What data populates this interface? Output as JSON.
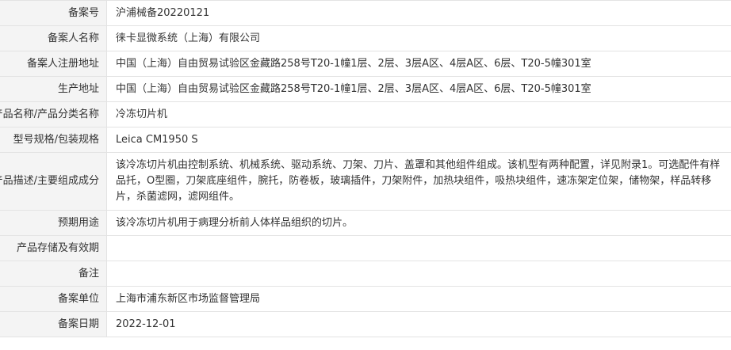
{
  "record": {
    "rows": [
      {
        "label": "备案号",
        "value": "沪浦械备20220121"
      },
      {
        "label": "备案人名称",
        "value": "徕卡显微系统（上海）有限公司"
      },
      {
        "label": "备案人注册地址",
        "value": "中国（上海）自由贸易试验区金藏路258号T20-1幢1层、2层、3层A区、4层A区、6层、T20-5幢301室"
      },
      {
        "label": "生产地址",
        "value": "中国（上海）自由贸易试验区金藏路258号T20-1幢1层、2层、3层A区、4层A区、6层、T20-5幢301室"
      },
      {
        "label": "产品名称/产品分类名称",
        "value": "冷冻切片机"
      },
      {
        "label": "型号规格/包装规格",
        "value": "Leica CM1950 S"
      },
      {
        "label": "产品描述/主要组成成分",
        "value": "该冷冻切片机由控制系统、机械系统、驱动系统、刀架、刀片、盖罩和其他组件组成。该机型有两种配置，详见附录1。可选配件有样品托，O型圈，刀架底座组件，腕托，防卷板，玻璃插件，刀架附件，加热块组件，吸热块组件，速冻架定位架，储物架，样品转移片，杀菌滤网，滤网组件。"
      },
      {
        "label": "预期用途",
        "value": "该冷冻切片机用于病理分析前人体样品组织的切片。"
      },
      {
        "label": "产品存储及有效期",
        "value": ""
      },
      {
        "label": "备注",
        "value": ""
      },
      {
        "label": "备案单位",
        "value": "上海市浦东新区市场监督管理局"
      },
      {
        "label": "备案日期",
        "value": "2022-12-01"
      }
    ]
  }
}
